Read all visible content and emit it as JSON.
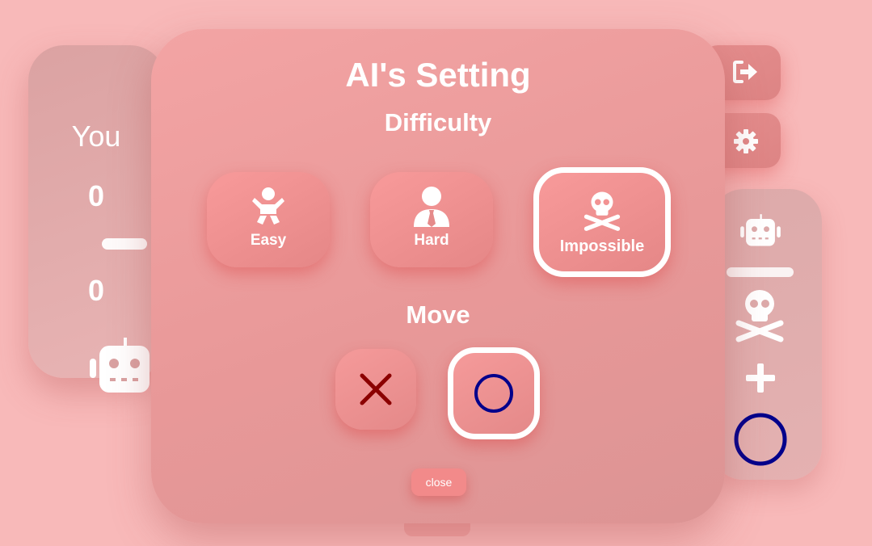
{
  "scoreboard": {
    "player_label": "You",
    "player_score": "0",
    "ai_score": "0",
    "ai_icon": "robot-icon"
  },
  "sidebar": {
    "exit_icon": "exit-icon",
    "settings_icon": "gear-icon"
  },
  "ai_panel": {
    "icon": "robot-icon",
    "difficulty_icon": "skull-crossbones-icon",
    "plus_icon": "plus-icon",
    "move_icon": "circle-icon"
  },
  "modal": {
    "title": "AI's Setting",
    "difficulty_heading": "Difficulty",
    "difficulties": [
      {
        "label": "Easy",
        "icon": "baby-icon",
        "selected": false
      },
      {
        "label": "Hard",
        "icon": "user-tie-icon",
        "selected": false
      },
      {
        "label": "Impossible",
        "icon": "skull-crossbones-icon",
        "selected": true
      }
    ],
    "move_heading": "Move",
    "moves": [
      {
        "icon": "x-mark-icon",
        "selected": false,
        "color": "#8b0000"
      },
      {
        "icon": "o-mark-icon",
        "selected": true,
        "color": "#00008b"
      }
    ],
    "close_label": "close"
  },
  "colors": {
    "background": "#f8b9b9",
    "x_mark": "#8b0000",
    "o_mark": "#00008b"
  }
}
